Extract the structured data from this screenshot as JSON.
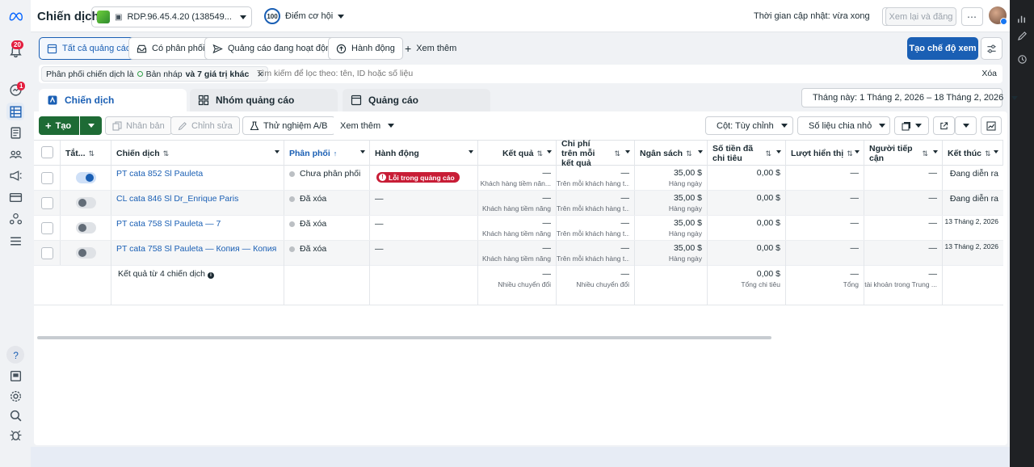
{
  "header": {
    "title": "Chiến dịch",
    "account_name": "RDP.96.45.4.20 (138549...",
    "opportunity_score": "100",
    "opportunity_label": "Điểm cơ hội",
    "updated_text": "Thời gian cập nhật: vừa xong",
    "review_publish_label": "Xem lại và đăng"
  },
  "rail": {
    "notifications_count": "20",
    "messages_count": "1"
  },
  "filter_tabs": [
    {
      "label": "Tất cả quảng cáo",
      "icon": "grid-icon",
      "active": true
    },
    {
      "label": "Có phân phối",
      "icon": "inbox-icon",
      "active": false
    },
    {
      "label": "Quảng cáo đang hoạt động",
      "icon": "send-icon",
      "active": false
    },
    {
      "label": "Hành động",
      "icon": "action-icon",
      "active": false
    },
    {
      "label": "Xem thêm",
      "icon": "plus-icon",
      "active": false
    }
  ],
  "create_view_label": "Tạo chế độ xem",
  "search": {
    "chip_prefix": "Phân phối chiến dịch là",
    "chip_value": "Bản nháp",
    "chip_suffix": "và 7 giá trị khác",
    "placeholder": "Tìm kiếm để lọc theo: tên, ID hoặc số liệu",
    "clear_label": "Xóa"
  },
  "level_tabs": [
    {
      "label": "Chiến dịch",
      "active": true
    },
    {
      "label": "Nhóm quảng cáo",
      "active": false
    },
    {
      "label": "Quảng cáo",
      "active": false
    }
  ],
  "date_range": "Tháng này: 1 Tháng 2, 2026 – 18 Tháng 2, 2026",
  "toolbar": {
    "create": "Tạo",
    "duplicate": "Nhân bản",
    "edit": "Chỉnh sửa",
    "ab_test": "Thử nghiệm A/B",
    "see_more": "Xem thêm",
    "columns": "Cột: Tùy chỉnh",
    "breakdown": "Số liệu chia nhỏ"
  },
  "table": {
    "headers": {
      "toggle": "Tắt...",
      "campaign": "Chiến dịch",
      "delivery": "Phân phối",
      "actions": "Hành động",
      "results": "Kết quả",
      "cost_per_result": "Chi phí trên mỗi kết quả",
      "budget": "Ngân sách",
      "amount_spent": "Số tiền đã chi tiêu",
      "impressions": "Lượt hiển thị",
      "reach": "Người tiếp cận",
      "ends": "Kết thúc"
    },
    "rows": [
      {
        "on": true,
        "name": "PT cata 852 Sl Pauleta",
        "delivery": "Chưa phân phối",
        "action": "Lỗi trong quảng cáo",
        "results": "—",
        "results_sub": "Khách hàng tiềm năn...",
        "cpr": "—",
        "cpr_sub": "Trên mỗi khách hàng t...",
        "budget": "35,00 $",
        "budget_sub": "Hàng ngày",
        "spent": "0,00 $",
        "impressions": "—",
        "reach": "—",
        "ends": "Đang diễn ra"
      },
      {
        "on": false,
        "name": "CL cata 846 Sl Dr_Enrique Paris",
        "delivery": "Đã xóa",
        "action": "—",
        "results": "—",
        "results_sub": "Khách hàng tiềm năng",
        "cpr": "—",
        "cpr_sub": "Trên mỗi khách hàng t...",
        "budget": "35,00 $",
        "budget_sub": "Hàng ngày",
        "spent": "0,00 $",
        "impressions": "—",
        "reach": "—",
        "ends": "Đang diễn ra"
      },
      {
        "on": false,
        "name": "PT cata 758 Sl Pauleta — 7",
        "delivery": "Đã xóa",
        "action": "—",
        "results": "—",
        "results_sub": "Khách hàng tiềm năng",
        "cpr": "—",
        "cpr_sub": "Trên mỗi khách hàng t...",
        "budget": "35,00 $",
        "budget_sub": "Hàng ngày",
        "spent": "0,00 $",
        "impressions": "—",
        "reach": "—",
        "ends": "13 Tháng 2, 2026"
      },
      {
        "on": false,
        "name": "PT cata 758 Sl Pauleta — Копия — Копия",
        "delivery": "Đã xóa",
        "action": "—",
        "results": "—",
        "results_sub": "Khách hàng tiềm năng",
        "cpr": "—",
        "cpr_sub": "Trên mỗi khách hàng t...",
        "budget": "35,00 $",
        "budget_sub": "Hàng ngày",
        "spent": "0,00 $",
        "impressions": "—",
        "reach": "—",
        "ends": "13 Tháng 2, 2026"
      }
    ],
    "summary": {
      "label": "Kết quả từ 4 chiến dịch",
      "results": "—",
      "results_sub": "Nhiều chuyển đổi",
      "cpr": "—",
      "cpr_sub": "Nhiều chuyển đổi",
      "spent": "0,00 $",
      "spent_sub": "Tổng chi tiêu",
      "impressions": "—",
      "impressions_sub": "Tổng",
      "reach": "—",
      "reach_sub": "tài khoản trong Trung ..."
    }
  },
  "colors": {
    "primary": "#1a5fb4",
    "create_green": "#1e6b35",
    "error_red": "#c81d36"
  }
}
